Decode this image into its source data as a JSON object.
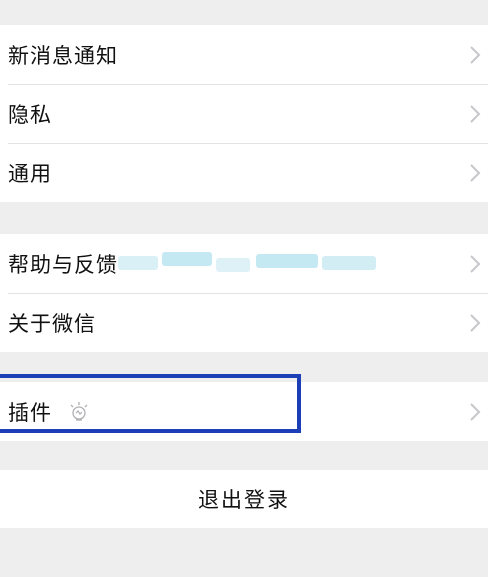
{
  "settings_group_1": {
    "items": [
      {
        "label": "新消息通知"
      },
      {
        "label": "隐私"
      },
      {
        "label": "通用"
      }
    ]
  },
  "settings_group_2": {
    "items": [
      {
        "label": "帮助与反馈"
      },
      {
        "label": "关于微信"
      }
    ]
  },
  "settings_group_3": {
    "items": [
      {
        "label": "插件",
        "icon": "lightbulb-icon"
      }
    ]
  },
  "logout": {
    "label": "退出登录"
  },
  "colors": {
    "background": "#eeeeef",
    "row_background": "#ffffff",
    "separator": "#e3e3e6",
    "chevron": "#c7c7cc",
    "highlight_box": "#1c3fb8",
    "text": "#111111"
  }
}
